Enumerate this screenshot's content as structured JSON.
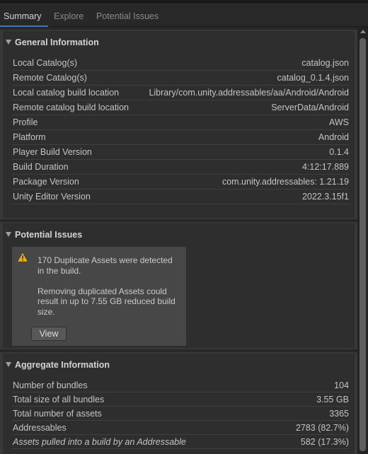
{
  "tabs": [
    {
      "label": "Summary",
      "active": true
    },
    {
      "label": "Explore",
      "active": false
    },
    {
      "label": "Potential Issues",
      "active": false
    }
  ],
  "general": {
    "title": "General Information",
    "rows": [
      {
        "key": "Local Catalog(s)",
        "value": "catalog.json"
      },
      {
        "key": "Remote Catalog(s)",
        "value": "catalog_0.1.4.json"
      },
      {
        "key": "Local catalog build location",
        "value": "Library/com.unity.addressables/aa/Android/Android"
      },
      {
        "key": "Remote catalog build location",
        "value": "ServerData/Android"
      },
      {
        "key": "Profile",
        "value": "AWS"
      },
      {
        "key": "Platform",
        "value": "Android"
      },
      {
        "key": "Player Build Version",
        "value": "0.1.4"
      },
      {
        "key": "Build Duration",
        "value": "4:12:17.889"
      },
      {
        "key": "Package Version",
        "value": "com.unity.addressables: 1.21.19"
      },
      {
        "key": "Unity Editor Version",
        "value": "2022.3.15f1"
      }
    ]
  },
  "issues": {
    "title": "Potential Issues",
    "warning_icon": "warning-triangle-icon",
    "warning_color": "#f0b400",
    "message_line1": "170 Duplicate Assets were detected in the build.",
    "message_line2": "Removing duplicated Assets could result in up to 7.55 GB reduced build size.",
    "button_label": "View"
  },
  "aggregate": {
    "title": "Aggregate Information",
    "rows": [
      {
        "key": "Number of bundles",
        "value": "104"
      },
      {
        "key": "Total size of all bundles",
        "value": "3.55 GB"
      },
      {
        "key": "Total number of assets",
        "value": "3365"
      },
      {
        "key": "Addressables",
        "value": "2783 (82.7%)"
      },
      {
        "key": "Assets pulled into a build by an Addressable",
        "value": "582 (17.3%)"
      }
    ]
  },
  "colors": {
    "accent": "#3a79bb",
    "background": "#282828",
    "panel": "#2e2e2e"
  }
}
